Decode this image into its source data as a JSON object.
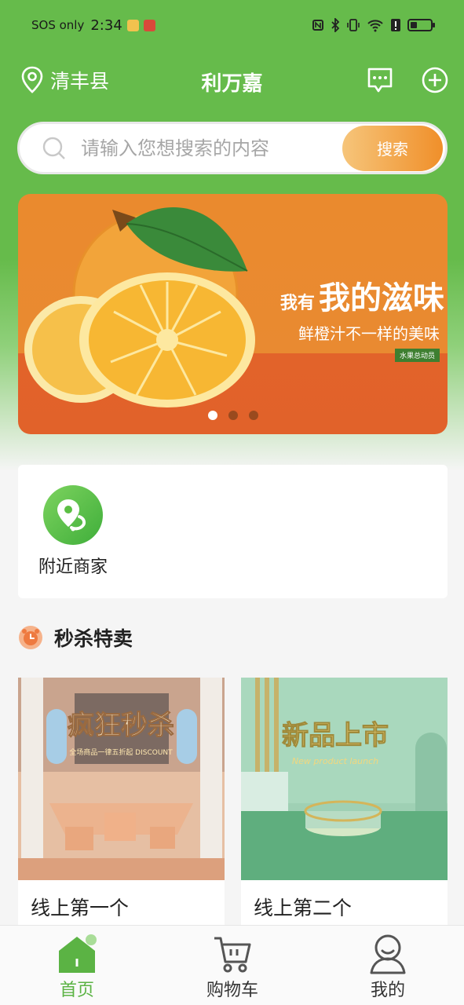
{
  "status_bar": {
    "carrier": "SOS only",
    "time": "2:34"
  },
  "header": {
    "location": "清丰县",
    "title": "利万嘉",
    "message_icon": "message-icon",
    "add_icon": "plus-circle-icon",
    "location_icon": "location-pin-icon"
  },
  "search": {
    "placeholder": "请输入您想搜索的内容",
    "button_label": "搜索"
  },
  "banner": {
    "small_text": "我有",
    "big_text": "我的滋味",
    "subtitle": "鲜橙汁不一样的美味",
    "tag": "水果总动员",
    "slide_count": 3,
    "active_slide": 1
  },
  "quick_links": {
    "items": [
      {
        "label": "附近商家",
        "icon": "nearby-pin-icon"
      }
    ]
  },
  "flash_sale": {
    "title": "秒杀特卖",
    "icon": "alarm-clock-icon",
    "products": [
      {
        "name": "线上第一个",
        "image_text_main": "疯狂秒杀",
        "image_text_sub": "全场商品一律五折起 DISCOUNT"
      },
      {
        "name": "线上第二个",
        "image_text_main": "新品上市",
        "image_text_sub": "New product launch"
      }
    ]
  },
  "tabbar": {
    "tabs": [
      {
        "label": "首页",
        "icon": "home-icon",
        "active": true
      },
      {
        "label": "购物车",
        "icon": "shopping-cart-icon",
        "active": false
      },
      {
        "label": "我的",
        "icon": "user-icon",
        "active": false
      }
    ]
  },
  "colors": {
    "brand_green": "#66bb4b",
    "accent_orange": "#f08f2a",
    "active_tab": "#5bb344"
  }
}
